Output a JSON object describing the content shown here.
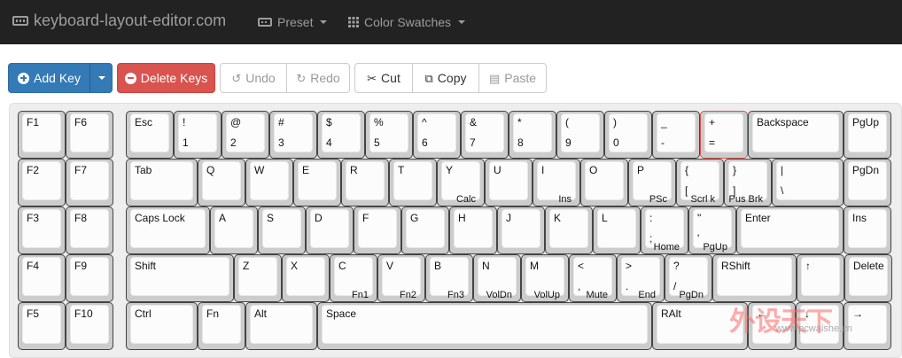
{
  "navbar": {
    "brand": "keyboard-layout-editor.com",
    "menus": [
      {
        "label": "Preset"
      },
      {
        "label": "Color Swatches"
      }
    ]
  },
  "toolbar": {
    "add_key": "Add Key",
    "delete_keys": "Delete Keys",
    "undo": "Undo",
    "redo": "Redo",
    "cut": "Cut",
    "copy": "Copy",
    "paste": "Paste"
  },
  "keyboard": {
    "keys": [
      {
        "tl": "F1",
        "bl": "",
        "br": ""
      },
      {
        "tl": "F6",
        "bl": "",
        "br": ""
      },
      {
        "tl": "Esc",
        "bl": "",
        "br": ""
      },
      {
        "tl": "!",
        "bl": "1",
        "br": ""
      },
      {
        "tl": "@",
        "bl": "2",
        "br": ""
      },
      {
        "tl": "#",
        "bl": "3",
        "br": ""
      },
      {
        "tl": "$",
        "bl": "4",
        "br": ""
      },
      {
        "tl": "%",
        "bl": "5",
        "br": ""
      },
      {
        "tl": "^",
        "bl": "6",
        "br": ""
      },
      {
        "tl": "&",
        "bl": "7",
        "br": ""
      },
      {
        "tl": "*",
        "bl": "8",
        "br": ""
      },
      {
        "tl": "(",
        "bl": "9",
        "br": ""
      },
      {
        "tl": ")",
        "bl": "0",
        "br": ""
      },
      {
        "tl": "_",
        "bl": "-",
        "br": ""
      },
      {
        "tl": "+",
        "bl": "=",
        "br": ""
      },
      {
        "tl": "Backspace",
        "bl": "",
        "br": ""
      },
      {
        "tl": "PgUp",
        "bl": "",
        "br": ""
      },
      {
        "tl": "F2",
        "bl": "",
        "br": ""
      },
      {
        "tl": "F7",
        "bl": "",
        "br": ""
      },
      {
        "tl": "Tab",
        "bl": "",
        "br": ""
      },
      {
        "tl": "Q",
        "bl": "",
        "br": ""
      },
      {
        "tl": "W",
        "bl": "",
        "br": ""
      },
      {
        "tl": "E",
        "bl": "",
        "br": ""
      },
      {
        "tl": "R",
        "bl": "",
        "br": ""
      },
      {
        "tl": "T",
        "bl": "",
        "br": ""
      },
      {
        "tl": "Y",
        "bl": "",
        "br": "Calc"
      },
      {
        "tl": "U",
        "bl": "",
        "br": ""
      },
      {
        "tl": "I",
        "bl": "",
        "br": "Ins"
      },
      {
        "tl": "O",
        "bl": "",
        "br": ""
      },
      {
        "tl": "P",
        "bl": "",
        "br": "PSc"
      },
      {
        "tl": "{",
        "bl": "[",
        "br": "Scrl k"
      },
      {
        "tl": "}",
        "bl": "]",
        "br": "Pus Brk"
      },
      {
        "tl": "|",
        "bl": "\\",
        "br": ""
      },
      {
        "tl": "PgDn",
        "bl": "",
        "br": ""
      },
      {
        "tl": "F3",
        "bl": "",
        "br": ""
      },
      {
        "tl": "F8",
        "bl": "",
        "br": ""
      },
      {
        "tl": "Caps Lock",
        "bl": "",
        "br": ""
      },
      {
        "tl": "A",
        "bl": "",
        "br": ""
      },
      {
        "tl": "S",
        "bl": "",
        "br": ""
      },
      {
        "tl": "D",
        "bl": "",
        "br": ""
      },
      {
        "tl": "F",
        "bl": "",
        "br": ""
      },
      {
        "tl": "G",
        "bl": "",
        "br": ""
      },
      {
        "tl": "H",
        "bl": "",
        "br": ""
      },
      {
        "tl": "J",
        "bl": "",
        "br": ""
      },
      {
        "tl": "K",
        "bl": "",
        "br": ""
      },
      {
        "tl": "L",
        "bl": "",
        "br": ""
      },
      {
        "tl": ":",
        "bl": ";",
        "br": "Home"
      },
      {
        "tl": "\"",
        "bl": "'",
        "br": "PgUp"
      },
      {
        "tl": "Enter",
        "bl": "",
        "br": ""
      },
      {
        "tl": "Ins",
        "bl": "",
        "br": ""
      },
      {
        "tl": "F4",
        "bl": "",
        "br": ""
      },
      {
        "tl": "F9",
        "bl": "",
        "br": ""
      },
      {
        "tl": "Shift",
        "bl": "",
        "br": ""
      },
      {
        "tl": "Z",
        "bl": "",
        "br": ""
      },
      {
        "tl": "X",
        "bl": "",
        "br": ""
      },
      {
        "tl": "C",
        "bl": "",
        "br": "Fn1"
      },
      {
        "tl": "V",
        "bl": "",
        "br": "Fn2"
      },
      {
        "tl": "B",
        "bl": "",
        "br": "Fn3"
      },
      {
        "tl": "N",
        "bl": "",
        "br": "VolDn"
      },
      {
        "tl": "M",
        "bl": "",
        "br": "VolUp"
      },
      {
        "tl": "<",
        "bl": ",",
        "br": "Mute"
      },
      {
        "tl": ">",
        "bl": ".",
        "br": "End"
      },
      {
        "tl": "?",
        "bl": "/",
        "br": "PgDn"
      },
      {
        "tl": "RShift",
        "bl": "",
        "br": ""
      },
      {
        "tl": "↑",
        "bl": "",
        "br": ""
      },
      {
        "tl": "Delete",
        "bl": "",
        "br": ""
      },
      {
        "tl": "F5",
        "bl": "",
        "br": ""
      },
      {
        "tl": "F10",
        "bl": "",
        "br": ""
      },
      {
        "tl": "Ctrl",
        "bl": "",
        "br": ""
      },
      {
        "tl": "Fn",
        "bl": "",
        "br": ""
      },
      {
        "tl": "Alt",
        "bl": "",
        "br": ""
      },
      {
        "tl": "Space",
        "bl": "",
        "br": ""
      },
      {
        "tl": "RAlt",
        "bl": "",
        "br": ""
      },
      {
        "tl": "←",
        "bl": "",
        "br": ""
      },
      {
        "tl": "↓",
        "bl": "",
        "br": ""
      },
      {
        "tl": "→",
        "bl": "",
        "br": ""
      }
    ]
  },
  "watermark": {
    "text": "外设天下",
    "url": "www.pcwaishe.cn"
  },
  "colors": {
    "navbar": "#222222",
    "primary": "#337ab7",
    "danger": "#d9534f",
    "selected_key_border": "#d9534f"
  }
}
